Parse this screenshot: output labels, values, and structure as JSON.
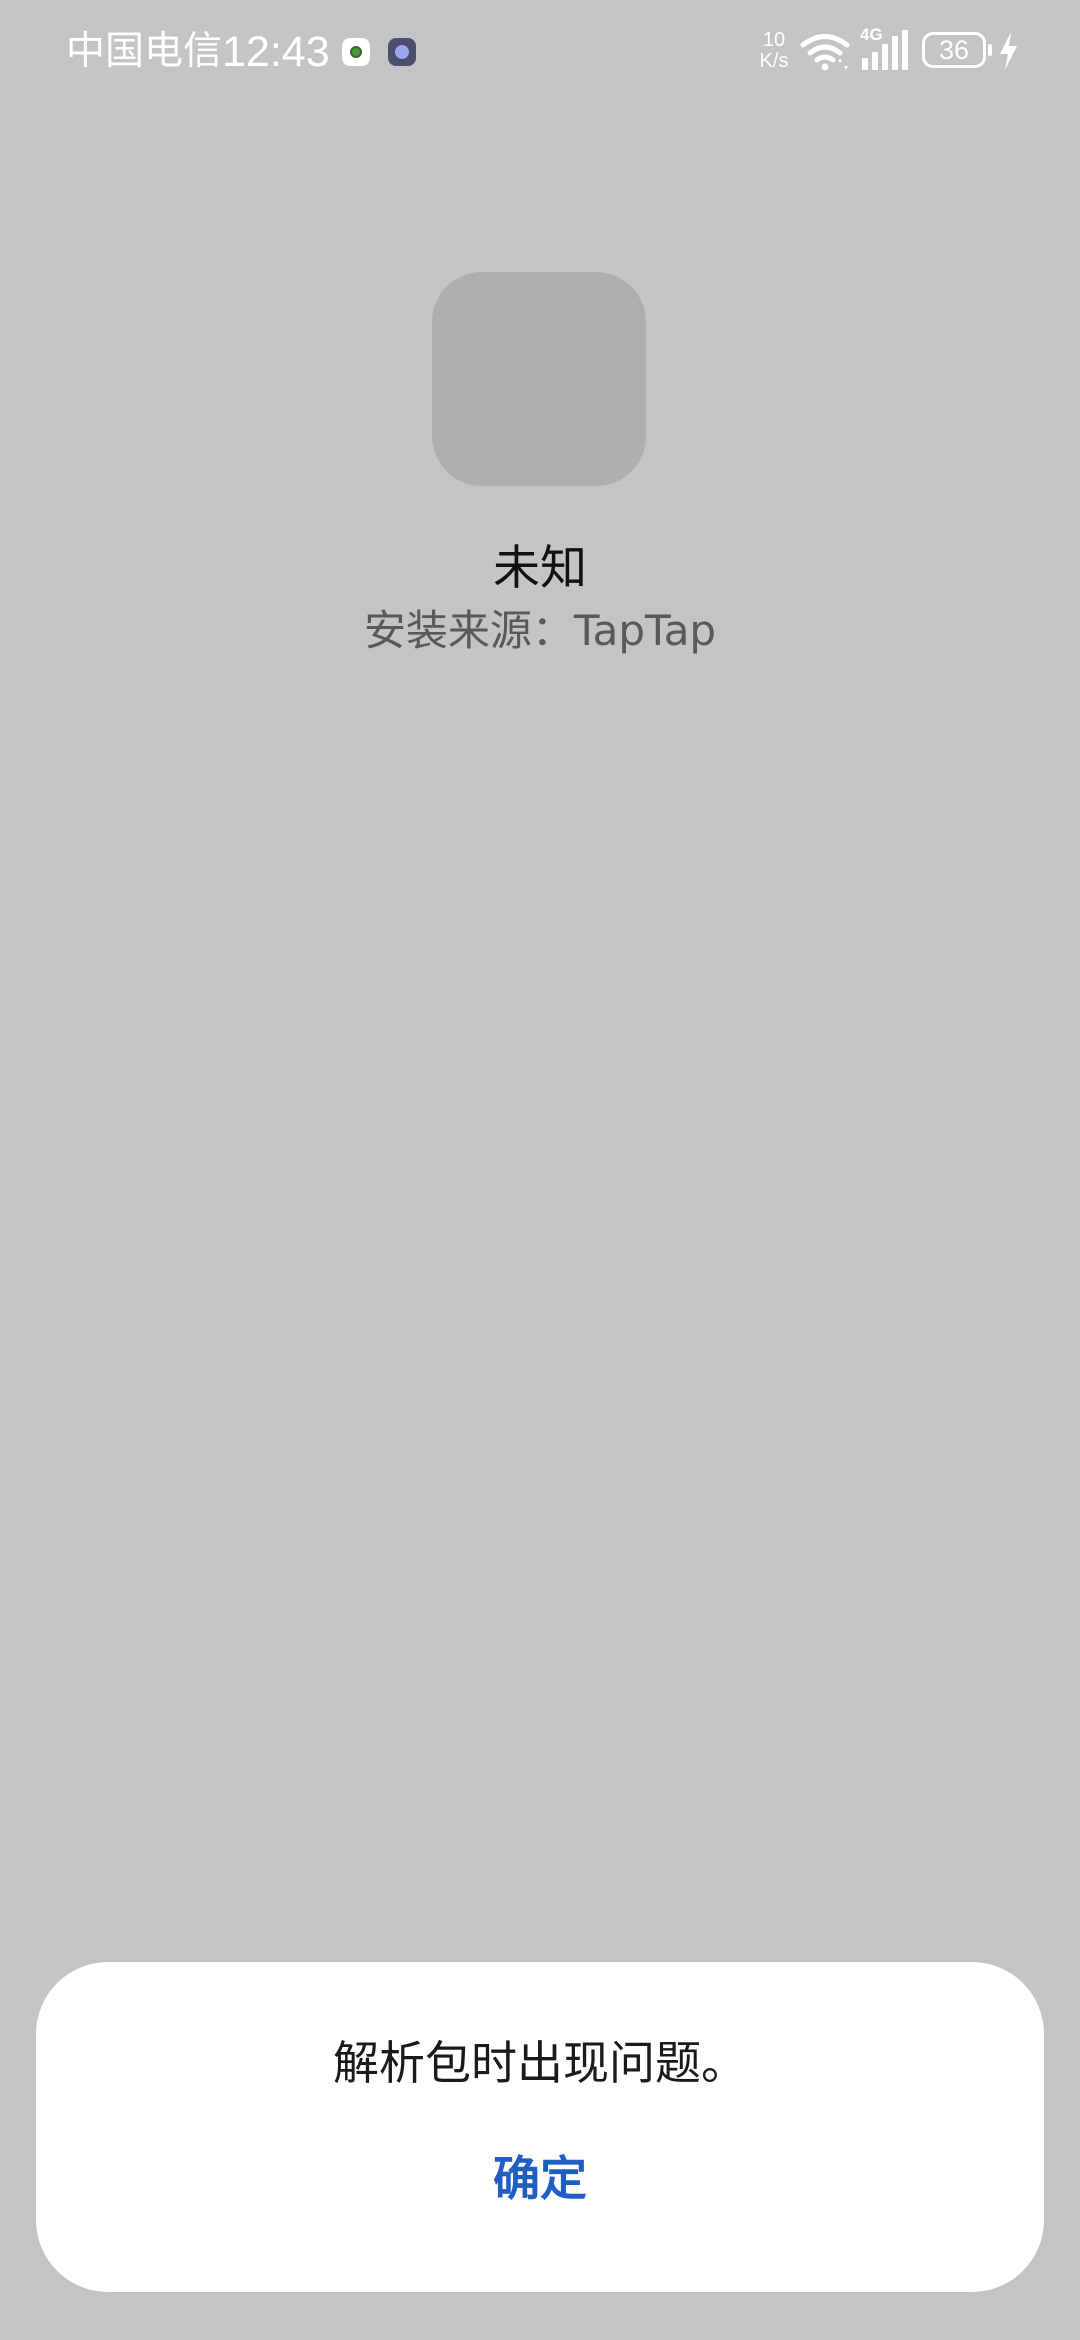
{
  "status_bar": {
    "carrier": "中国电信",
    "time": "12:43",
    "notification_icons": [
      "app-notification-icon",
      "assistant-notification-icon"
    ],
    "net_speed_value": "10",
    "net_speed_unit": "K/s",
    "network_type": "4G",
    "battery_level": "36",
    "charging": true
  },
  "app": {
    "icon": "placeholder-app-icon",
    "name": "未知",
    "install_source": "安装来源：TapTap"
  },
  "dialog": {
    "message": "解析包时出现问题。",
    "confirm_label": "确定"
  },
  "colors": {
    "background": "#c3c4c6",
    "dialog_background": "#ffffff",
    "accent": "#1f5fc4"
  }
}
